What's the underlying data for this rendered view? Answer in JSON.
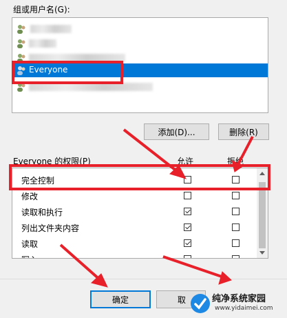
{
  "groups": {
    "label": "组或用户名(G):",
    "items": [
      {
        "name": "",
        "blurred": true,
        "selected": false
      },
      {
        "name": "",
        "blurred": true,
        "selected": false
      },
      {
        "name": "",
        "blurred": true,
        "selected": false
      },
      {
        "name": "Everyone",
        "blurred": false,
        "selected": true
      },
      {
        "name": "",
        "blurred": true,
        "selected": false
      }
    ]
  },
  "buttons": {
    "add": "添加(D)...",
    "remove": "删除(R)",
    "ok": "确定",
    "cancel": "取"
  },
  "permissions": {
    "header": "Everyone 的权限(P)",
    "allow_col": "允许",
    "deny_col": "拒绝",
    "rows": [
      {
        "name": "完全控制",
        "allow": false,
        "deny": false
      },
      {
        "name": "修改",
        "allow": false,
        "deny": false
      },
      {
        "name": "读取和执行",
        "allow": true,
        "deny": false
      },
      {
        "name": "列出文件夹内容",
        "allow": true,
        "deny": false
      },
      {
        "name": "读取",
        "allow": true,
        "deny": false
      },
      {
        "name": "写入",
        "allow": false,
        "deny": false
      }
    ]
  },
  "watermark": {
    "title": "纯净系统家园",
    "url": "www.yidaimei.com"
  },
  "colors": {
    "selection": "#0078d7",
    "annotation": "#e8202a"
  }
}
